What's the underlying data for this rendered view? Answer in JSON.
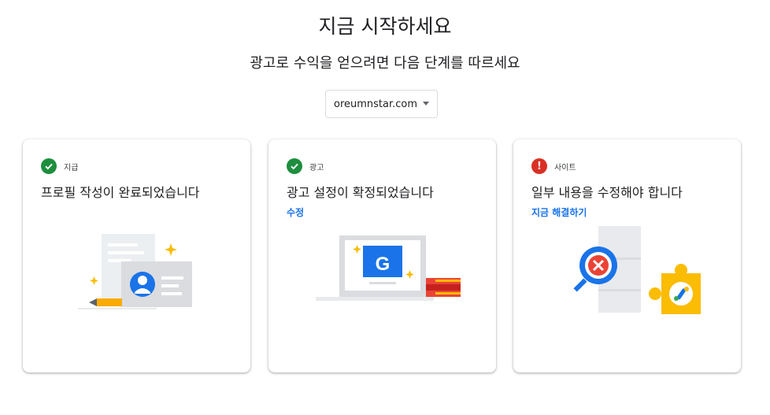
{
  "header": {
    "title": "지금 시작하세요",
    "subtitle": "광고로 수익을 얻으려면 다음 단계를 따르세요"
  },
  "site_selector": {
    "selected": "oreumnstar.com"
  },
  "cards": [
    {
      "status": "complete",
      "tag": "지급",
      "heading": "프로필 작성이 완료되었습니다",
      "link": ""
    },
    {
      "status": "complete",
      "tag": "광고",
      "heading": "광고 설정이 확정되었습니다",
      "link": "수정"
    },
    {
      "status": "error",
      "tag": "사이트",
      "heading": "일부 내용을 수정해야 합니다",
      "link": "지금 해결하기"
    }
  ],
  "colors": {
    "success": "#1e8e3e",
    "error": "#d93025",
    "link": "#1a73e8",
    "google_blue": "#1a73e8",
    "yellow": "#fbbc04"
  }
}
